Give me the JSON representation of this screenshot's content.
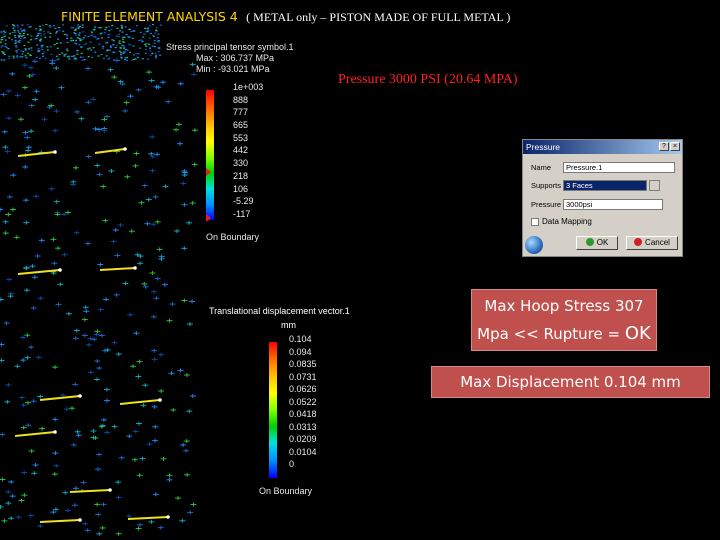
{
  "title": {
    "main": "FINITE ELEMENT ANALYSIS 4",
    "subtitle": "( METAL only – PISTON MADE OF FULL METAL )"
  },
  "stress_legend": {
    "header": "Stress principal tensor symbol.1",
    "max": "Max : 306.737 MPa",
    "min": "Min : -93.021 MPa",
    "ticks": [
      "1e+003",
      "888",
      "777",
      "665",
      "553",
      "442",
      "330",
      "218",
      "106",
      "-5.29",
      "-117"
    ],
    "boundary": "On Boundary"
  },
  "displacement_legend": {
    "header": "Translational displacement vector.1",
    "unit": "mm",
    "ticks": [
      "0.104",
      "0.094",
      "0.0835",
      "0.0731",
      "0.0626",
      "0.0522",
      "0.0418",
      "0.0313",
      "0.0209",
      "0.0104",
      "0"
    ],
    "boundary": "On Boundary"
  },
  "pressure_heading": "Pressure 3000 PSI (20.64 MPA)",
  "dialog": {
    "title": "Pressure",
    "name_label": "Name",
    "name_value": "Pressure.1",
    "supports_label": "Supports",
    "supports_value": "3 Faces",
    "pressure_label": "Pressure",
    "pressure_value": "3000psi",
    "mapping_label": "Data Mapping",
    "ok_label": "OK",
    "cancel_label": "Cancel"
  },
  "hoop_box": {
    "line1": "Max Hoop Stress 307",
    "line2": "Mpa << Rupture = ",
    "ok": "OK"
  },
  "displacement_box": "Max Displacement  0.104 mm",
  "colors": {
    "title": "#ffd700",
    "heading": "#ff2020",
    "box": "#c0504d",
    "arrow": "#f0e020"
  }
}
